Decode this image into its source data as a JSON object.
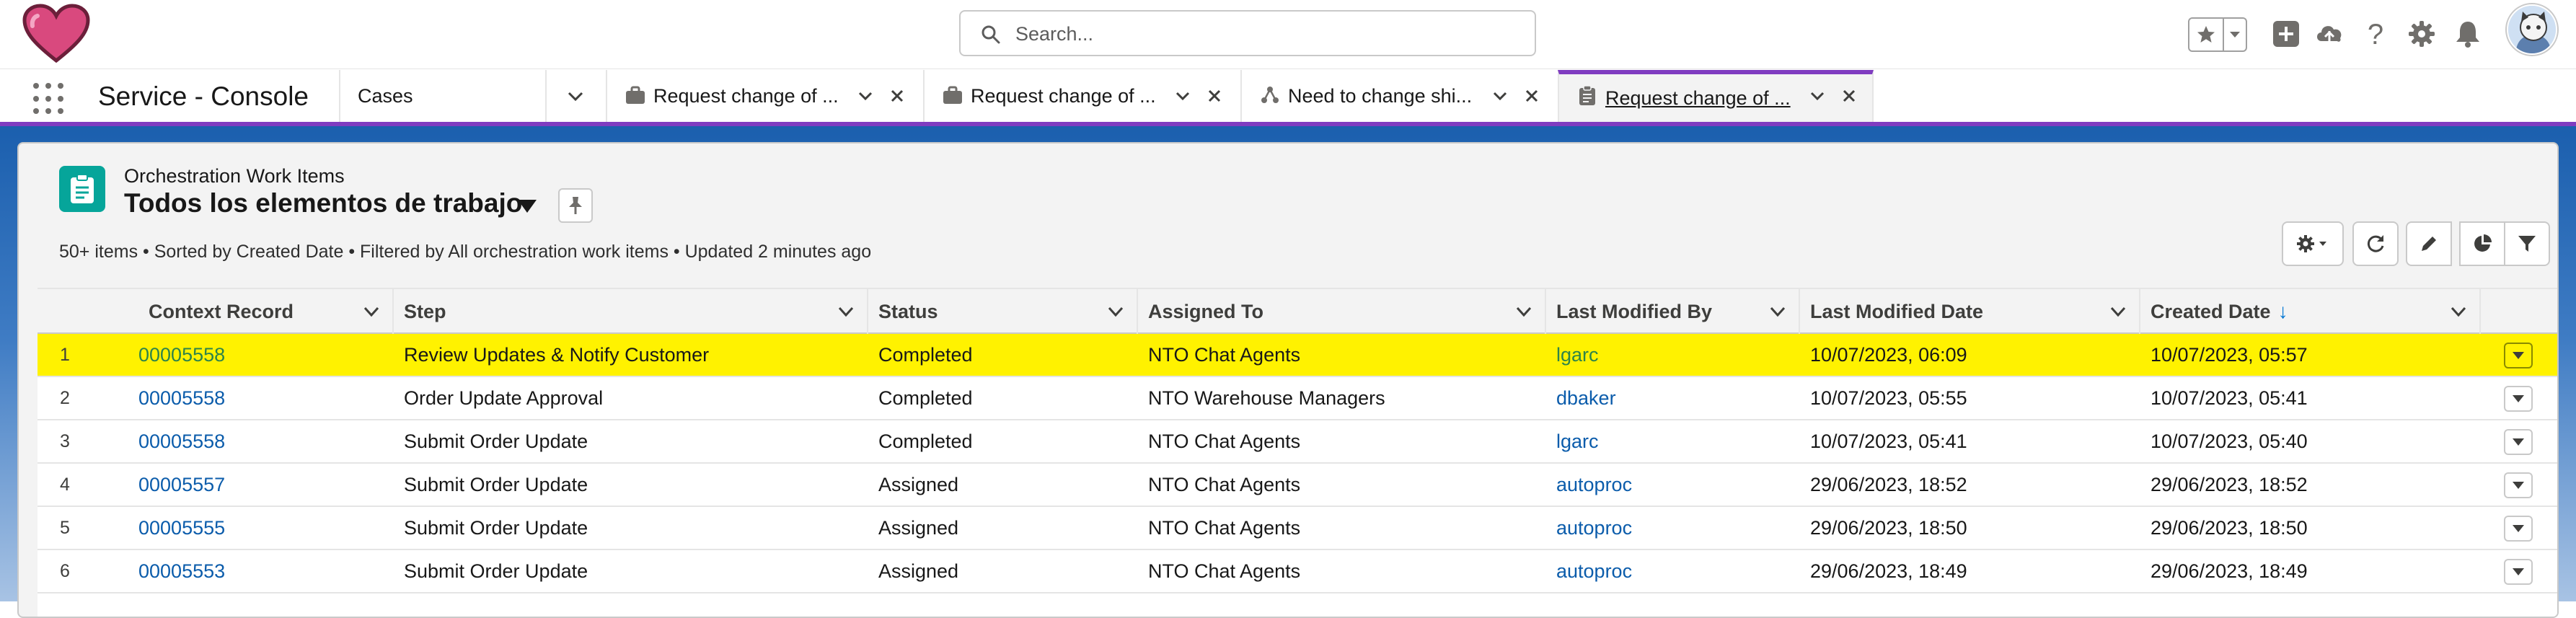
{
  "header": {
    "search_placeholder": "Search...",
    "icons": [
      "favorites-star-icon",
      "favorites-dropdown-icon",
      "global-actions-add-icon",
      "trailhead-icon",
      "help-icon",
      "setup-gear-icon",
      "notifications-bell-icon",
      "user-avatar"
    ]
  },
  "nav": {
    "app_name": "Service - Console",
    "object_tab": "Cases",
    "tabs": [
      {
        "label": "Request change of ...",
        "icon": "case-briefcase-icon"
      },
      {
        "label": "Request change of ...",
        "icon": "case-briefcase-icon"
      },
      {
        "label": "Need to change shi...",
        "icon": "orchestration-flow-icon"
      },
      {
        "label": "Request change of ...",
        "icon": "clipboard-icon",
        "active": true
      }
    ]
  },
  "listview": {
    "object_label": "Orchestration Work Items",
    "title": "Todos los elementos de trabajo",
    "meta": "50+ items • Sorted by Created Date • Filtered by All orchestration work items • Updated 2 minutes ago",
    "columns": [
      "Context Record",
      "Step",
      "Status",
      "Assigned To",
      "Last Modified By",
      "Last Modified Date",
      "Created Date"
    ],
    "sort_column": "Created Date",
    "sort_indicator": "↓",
    "rows": [
      {
        "num": "1",
        "context": "00005558",
        "step": "Review Updates & Notify Customer",
        "status": "Completed",
        "assigned": "NTO Chat Agents",
        "modified_by": "lgarc",
        "modified_date": "10/07/2023, 06:09",
        "created": "10/07/2023, 05:57",
        "highlighted": true
      },
      {
        "num": "2",
        "context": "00005558",
        "step": "Order Update Approval",
        "status": "Completed",
        "assigned": "NTO Warehouse Managers",
        "modified_by": "dbaker",
        "modified_date": "10/07/2023, 05:55",
        "created": "10/07/2023, 05:41"
      },
      {
        "num": "3",
        "context": "00005558",
        "step": "Submit Order Update",
        "status": "Completed",
        "assigned": "NTO Chat Agents",
        "modified_by": "lgarc",
        "modified_date": "10/07/2023, 05:41",
        "created": "10/07/2023, 05:40"
      },
      {
        "num": "4",
        "context": "00005557",
        "step": "Submit Order Update",
        "status": "Assigned",
        "assigned": "NTO Chat Agents",
        "modified_by": "autoproc",
        "modified_date": "29/06/2023, 18:52",
        "created": "29/06/2023, 18:52"
      },
      {
        "num": "5",
        "context": "00005555",
        "step": "Submit Order Update",
        "status": "Assigned",
        "assigned": "NTO Chat Agents",
        "modified_by": "autoproc",
        "modified_date": "29/06/2023, 18:50",
        "created": "29/06/2023, 18:50"
      },
      {
        "num": "6",
        "context": "00005553",
        "step": "Submit Order Update",
        "status": "Assigned",
        "assigned": "NTO Chat Agents",
        "modified_by": "autoproc",
        "modified_date": "29/06/2023, 18:49",
        "created": "29/06/2023, 18:49"
      }
    ]
  },
  "colors": {
    "accent_purple": "#7f3cc0",
    "link_blue": "#0b5cab",
    "highlight_yellow": "#fff200",
    "object_icon_teal": "#06a59a",
    "logo_heart": "#d9497e"
  }
}
